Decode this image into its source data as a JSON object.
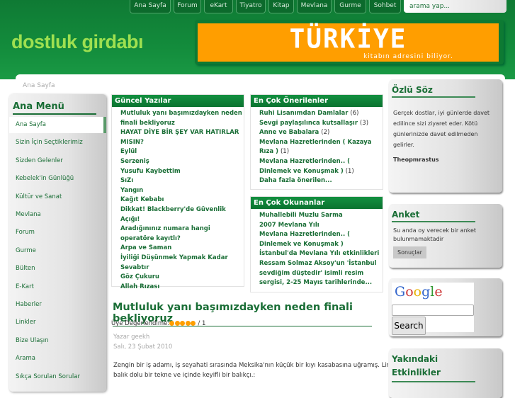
{
  "nav": [
    "Ana Sayfa",
    "Forum",
    "eKart",
    "Tiyatro",
    "Kitap",
    "Mevlana",
    "Gurme",
    "Sohbet"
  ],
  "search_placeholder": "arama yap...",
  "logo": "dostluk girdabı",
  "banner": {
    "title": "TÜRKİYE",
    "subtitle": "kitabın adresini biliyor."
  },
  "breadcrumb": "Ana Sayfa",
  "menu": {
    "title": "Ana Menü",
    "items": [
      "Ana Sayfa",
      "Sizin İçin Seçtiklerimiz",
      "Sizden Gelenler",
      "Kebelek'in Günlüğü",
      "Kültür ve Sanat",
      "Mevlana",
      "Forum",
      "Gurme",
      "Bülten",
      "E-Kart",
      "Haberler",
      "Linkler",
      "Bize Ulaşın",
      "Arama",
      "Sıkça Sorulan Sorular"
    ]
  },
  "guncel": {
    "title": "Güncel Yazılar",
    "items": [
      "Mutluluk yanı başımızdayken neden finali bekliyoruz",
      "HAYAT DİYE BİR ŞEY VAR HATIRLAR MISIN?",
      "Eylül",
      "Serzeniş",
      "Yusufu Kaybettim",
      "SıZı",
      "Yangın",
      "Kağıt Kebabı",
      "Dikkat! Blackberry'de Güvenlik Açığı!",
      "Aradığınınız numara hangi operatöre kayıtlı?",
      "Arpa ve Saman",
      "İyiliği Düşünmek Yapmak Kadar Sevabtır",
      "Göz Çukuru",
      "Allah Rızası"
    ]
  },
  "oneri": {
    "title": "En Çok Önerilenler",
    "items": [
      {
        "t": "Ruhi Lisanımdan Damlalar",
        "n": "(6)"
      },
      {
        "t": "Sevgi paylaşılınca kutsallaşır",
        "n": "(3)"
      },
      {
        "t": "Anne ve Babalara",
        "n": "(2)"
      },
      {
        "t": "Mevlana Hazretlerinden ( Kazaya Rıza )",
        "n": "(1)"
      },
      {
        "t": "Mevlana Hazretlerinden.. ( Dinlemek ve Konuşmak )",
        "n": "(1)"
      }
    ],
    "more": "Daha fazla önerilen..."
  },
  "okunan": {
    "title": "En Çok Okunanlar",
    "items": [
      "Muhallebili Muzlu Sarma",
      "2007 Mevlana Yılı",
      "Mevlana Hazretlerinden.. ( Dinlemek ve Konuşmak )",
      "İstanbul'da Mevlana Yılı etkinlikleri",
      "Ressam Solmaz Aksoy'un 'İstanbul sevdiğim düştedir' isimli resim sergisi, 2-25 Mayıs tarihlerinde..."
    ]
  },
  "ozlu": {
    "title": "Özlü Söz",
    "text": "Gerçek dostlar, iyi günlerde davet edilince sizi ziyaret eder. Kötü günlerinizde davet edilmeden gelirler.",
    "author": "Theopmrastus"
  },
  "anket": {
    "title": "Anket",
    "text": "Su anda oy verecek bir anket bulunmamaktadir",
    "button": "Sonuçlar"
  },
  "google": {
    "logo": "Google",
    "button": "Search"
  },
  "etkinlik": {
    "title": "Yakındaki Etkinlikler"
  },
  "article": {
    "title": "Mutluluk yanı başımızdayken neden finali bekliyoruz",
    "rating_label": "Üye Değerlendime:",
    "rating": 5,
    "rating_suffix": "/ 1",
    "author": "Yazar geekh",
    "date": "Salı, 23 Şubat 2010",
    "p1": "Zengin bir iş adamı, iş seyahati sırasında Meksika'nın küçük bir kıyı kasabasına uğramış. Lim",
    "p2": "balık dolu bir tekne ve içinde keyifli bir balıkçı.:"
  }
}
